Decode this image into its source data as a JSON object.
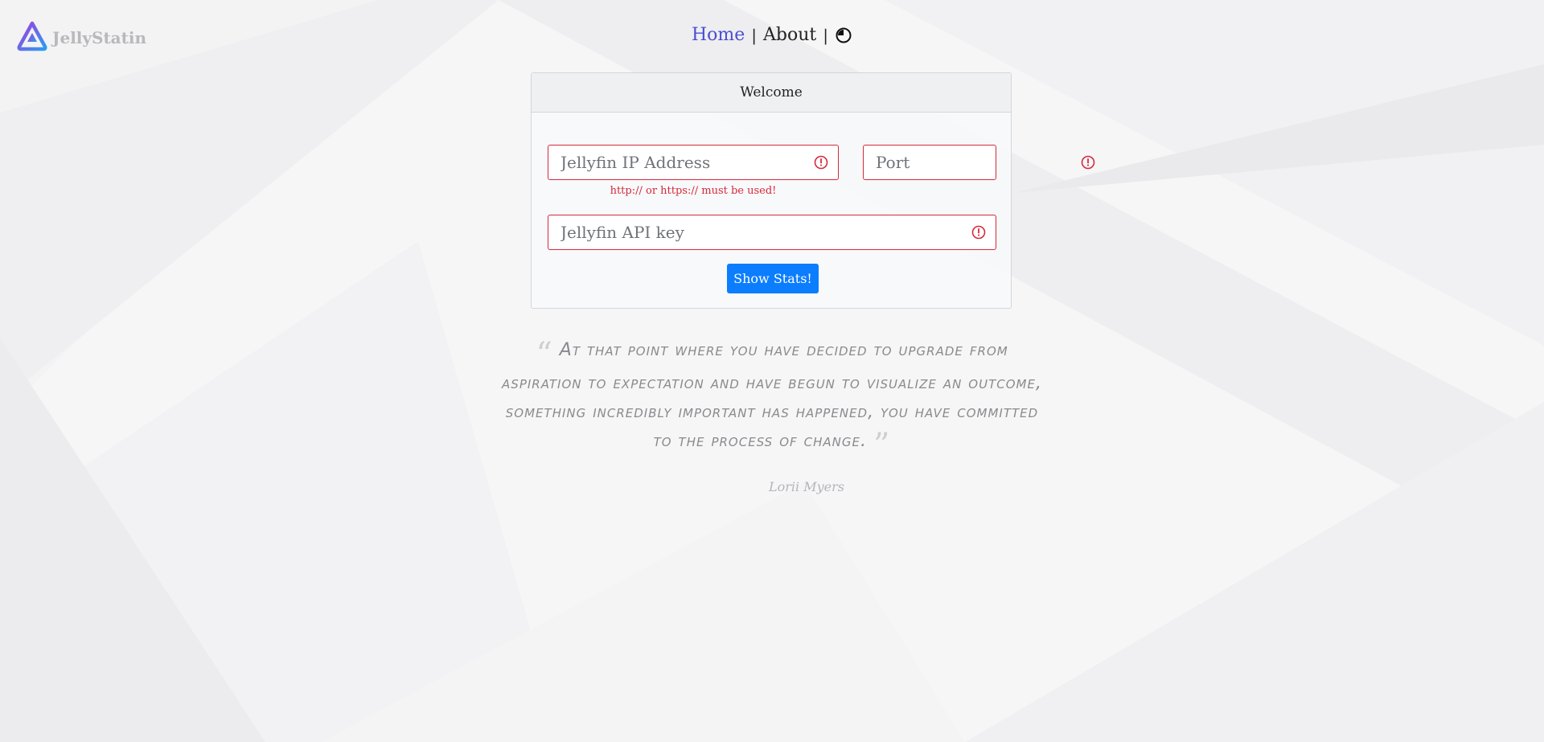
{
  "app": {
    "name": "JellyStatin"
  },
  "nav": {
    "home_label": "Home",
    "about_label": "About",
    "separator": "|",
    "theme_icon": "half-moon-icon"
  },
  "card": {
    "title": "Welcome",
    "fields": {
      "ip_placeholder": "Jellyfin IP Address",
      "ip_value": "",
      "port_placeholder": "Port",
      "port_value": "",
      "api_placeholder": "Jellyfin API key",
      "api_value": ""
    },
    "ip_error": "http:// or https:// must be used!",
    "submit_label": "Show Stats!"
  },
  "quote": {
    "open_mark": "“",
    "text": "At that point where you have decided to upgrade from aspiration to expectation and have begun to visualize an outcome, something incredibly important has happened, you have committed to the process of change.",
    "close_mark": "”",
    "author": "Lorii Myers"
  },
  "colors": {
    "primary_button": "#0b7dff",
    "error": "#d6293b",
    "link_active": "#4a4fd0"
  }
}
